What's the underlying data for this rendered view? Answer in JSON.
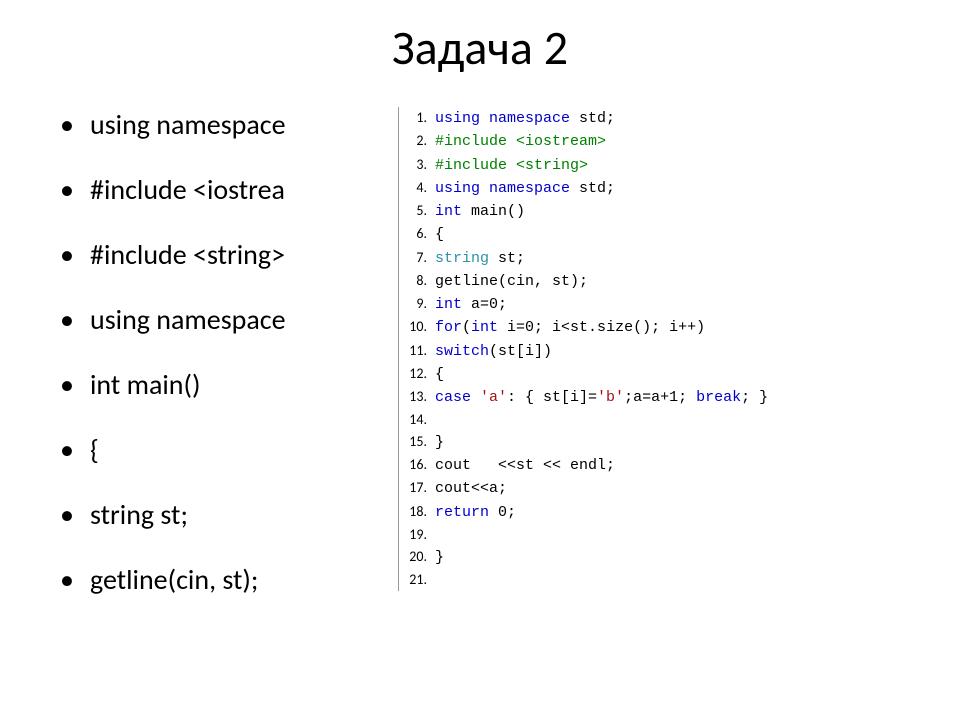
{
  "title": "Задача 2",
  "bullets": [
    "using namespace",
    "#include <iostrea",
    "#include <string>",
    "using namespace",
    "int main()",
    "{",
    "string st;",
    "getline(cin, st);"
  ],
  "code_lines": [
    {
      "n": "1.",
      "segs": [
        {
          "t": "using ",
          "c": "kw"
        },
        {
          "t": "namespace ",
          "c": "kw"
        },
        {
          "t": "std;",
          "c": ""
        }
      ]
    },
    {
      "n": "2.",
      "segs": [
        {
          "t": "#include <iostream>",
          "c": "pp"
        }
      ]
    },
    {
      "n": "3.",
      "segs": [
        {
          "t": "#include <string>",
          "c": "pp"
        }
      ]
    },
    {
      "n": "4.",
      "segs": [
        {
          "t": "using ",
          "c": "kw"
        },
        {
          "t": "namespace ",
          "c": "kw"
        },
        {
          "t": "std;",
          "c": ""
        }
      ]
    },
    {
      "n": "5.",
      "segs": [
        {
          "t": "int ",
          "c": "kw"
        },
        {
          "t": "main()",
          "c": ""
        }
      ]
    },
    {
      "n": "6.",
      "segs": [
        {
          "t": "{",
          "c": ""
        }
      ]
    },
    {
      "n": "7.",
      "segs": [
        {
          "t": "string ",
          "c": "ty"
        },
        {
          "t": "st;",
          "c": ""
        }
      ]
    },
    {
      "n": "8.",
      "segs": [
        {
          "t": "getline(cin, st);",
          "c": ""
        }
      ]
    },
    {
      "n": "9.",
      "segs": [
        {
          "t": "int ",
          "c": "kw"
        },
        {
          "t": "a=0;",
          "c": ""
        }
      ]
    },
    {
      "n": "10.",
      "segs": [
        {
          "t": "for",
          "c": "kw"
        },
        {
          "t": "(",
          "c": ""
        },
        {
          "t": "int ",
          "c": "kw"
        },
        {
          "t": "i=0; i<st.size(); i++)",
          "c": ""
        }
      ]
    },
    {
      "n": "11.",
      "segs": [
        {
          "t": "switch",
          "c": "kw"
        },
        {
          "t": "(st[i])",
          "c": ""
        }
      ]
    },
    {
      "n": "12.",
      "segs": [
        {
          "t": "{",
          "c": ""
        }
      ]
    },
    {
      "n": "13.",
      "segs": [
        {
          "t": "case ",
          "c": "kw"
        },
        {
          "t": "'a'",
          "c": "str"
        },
        {
          "t": ": { st[i]=",
          "c": ""
        },
        {
          "t": "'b'",
          "c": "str"
        },
        {
          "t": ";a=a+1; ",
          "c": ""
        },
        {
          "t": "break",
          "c": "kw"
        },
        {
          "t": "; }",
          "c": ""
        }
      ]
    },
    {
      "n": "14.",
      "segs": [
        {
          "t": "",
          "c": ""
        }
      ]
    },
    {
      "n": "15.",
      "segs": [
        {
          "t": "}",
          "c": ""
        }
      ]
    },
    {
      "n": "16.",
      "segs": [
        {
          "t": "cout   <<st << endl;",
          "c": ""
        }
      ]
    },
    {
      "n": "17.",
      "segs": [
        {
          "t": "cout<<a;",
          "c": ""
        }
      ]
    },
    {
      "n": "18.",
      "segs": [
        {
          "t": "return ",
          "c": "kw"
        },
        {
          "t": "0;",
          "c": ""
        }
      ]
    },
    {
      "n": "19.",
      "segs": [
        {
          "t": "",
          "c": ""
        }
      ]
    },
    {
      "n": "20.",
      "segs": [
        {
          "t": "}",
          "c": ""
        }
      ]
    },
    {
      "n": "21.",
      "segs": [
        {
          "t": "",
          "c": ""
        }
      ]
    }
  ]
}
